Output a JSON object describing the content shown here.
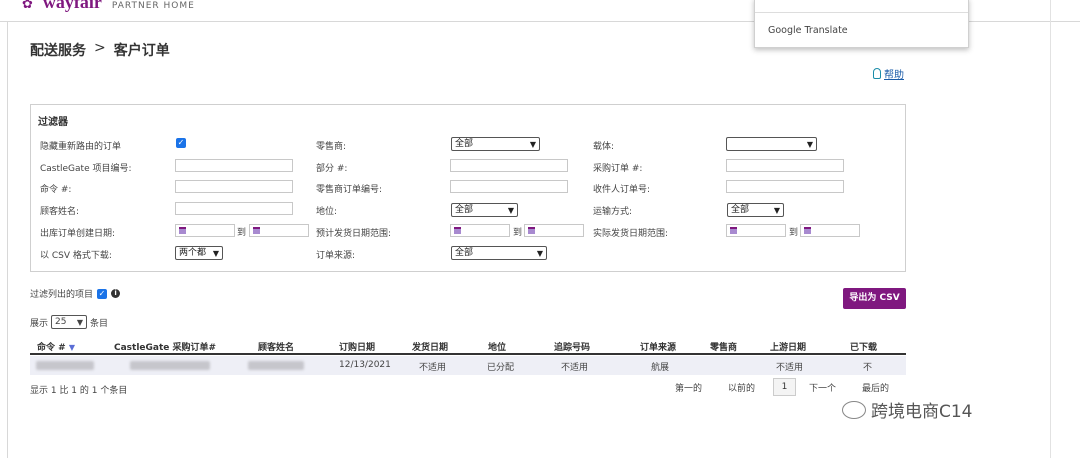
{
  "header": {
    "logo_text": "wayfair",
    "logo_subtitle": "PARTNER HOME"
  },
  "translate_popup": {
    "label": "Google Translate"
  },
  "breadcrumb": {
    "parent": "配送服务",
    "separator": ">",
    "current": "客户订单"
  },
  "help": {
    "label": "帮助"
  },
  "filters": {
    "title": "过滤器",
    "hide_rerouted_label": "隐藏重新路由的订单",
    "hide_rerouted_checked": true,
    "castlegate_label": "CastleGate 项目编号:",
    "order_no_label": "命令 #:",
    "customer_name_label": "顾客姓名:",
    "outbound_date_label": "出库订单创建日期:",
    "csv_label": "以 CSV 格式下载:",
    "csv_value": "两个都",
    "retailer_label": "零售商:",
    "retailer_value": "全部",
    "part_label": "部分 #:",
    "retailer_order_label": "零售商订单编号:",
    "status_label": "地位:",
    "status_value": "全部",
    "est_ship_label": "预计发货日期范围:",
    "order_source_label": "订单来源:",
    "order_source_value": "全部",
    "carrier_label": "载体:",
    "carrier_value": "",
    "po_label": "采购订单 #:",
    "recipient_label": "收件人订单号:",
    "ship_method_label": "运输方式:",
    "ship_method_value": "全部",
    "actual_ship_label": "实际发货日期范围:",
    "to_label": "到"
  },
  "list_filter": {
    "label": "过滤列出的项目",
    "checked": true
  },
  "export_button": "导出为 CSV",
  "show": {
    "prefix": "展示",
    "value": "25",
    "suffix": "条目"
  },
  "table": {
    "columns": [
      "命令 #",
      "CastleGate 采购订单#",
      "顾客姓名",
      "订购日期",
      "发货日期",
      "地位",
      "追踪号码",
      "订单来源",
      "零售商",
      "上游日期",
      "已下载"
    ],
    "rows": [
      {
        "order_date": "12/13/2021",
        "ship_date": "不适用",
        "status": "已分配",
        "tracking": "不适用",
        "source": "航展",
        "retailer": "",
        "upstream_date": "不适用",
        "downloaded": "不"
      }
    ]
  },
  "table_info": "显示 1 比 1 的 1 个条目",
  "pager": {
    "first": "第一的",
    "previous": "以前的",
    "current": "1",
    "next": "下一个",
    "last": "最后的"
  },
  "watermark": "跨境电商C14"
}
